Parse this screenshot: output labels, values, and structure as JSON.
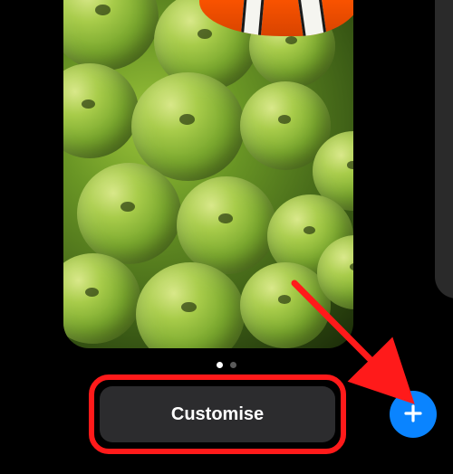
{
  "buttons": {
    "customise_label": "Customise"
  },
  "icons": {
    "add": "plus-icon"
  },
  "page_indicator": {
    "count": 2,
    "active": 0
  },
  "colors": {
    "accent": "#0a84ff",
    "highlight": "#ff1a1a",
    "button_bg": "#2c2c2e"
  },
  "annotation": {
    "has_highlight_box": true,
    "has_arrow": true,
    "arrow_target": "add-button"
  }
}
